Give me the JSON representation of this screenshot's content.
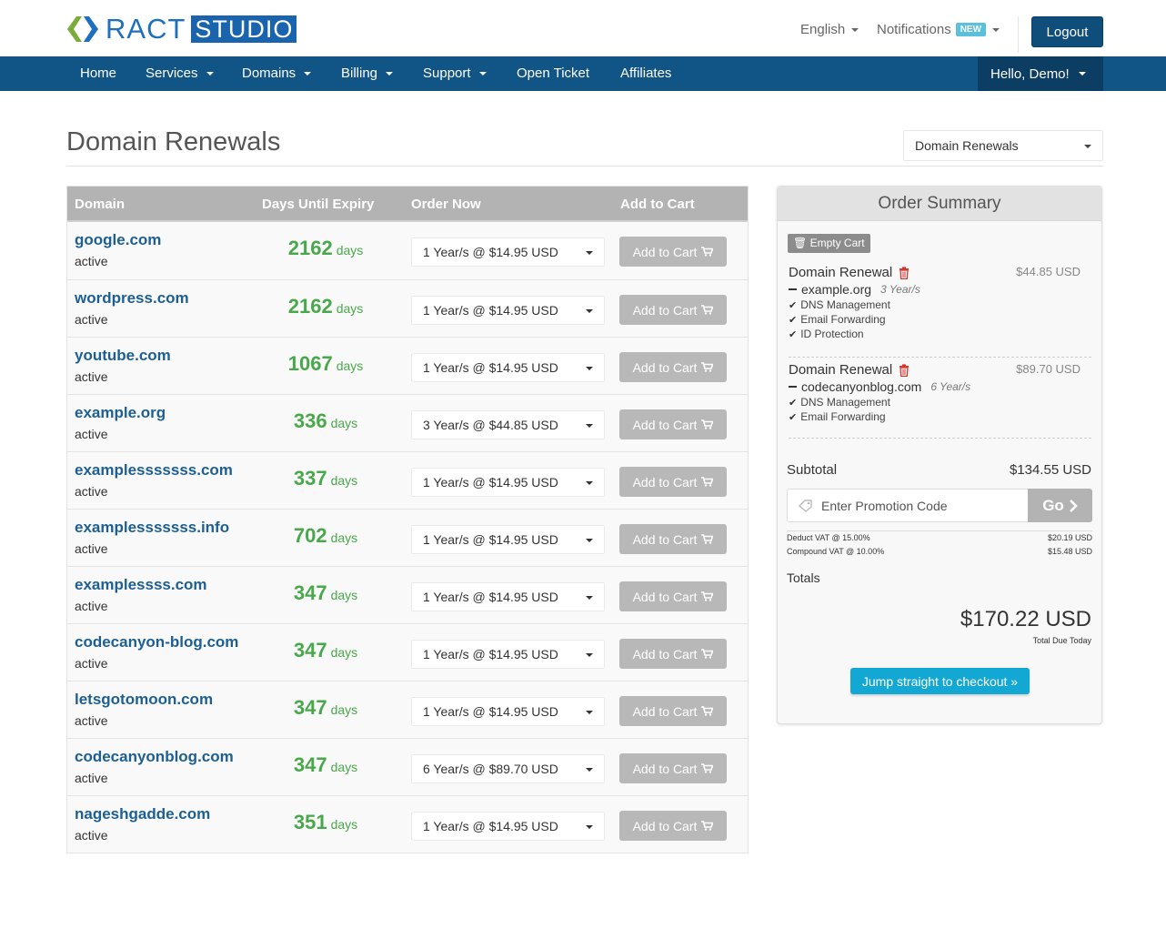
{
  "brand": {
    "ract": "RACT",
    "studio": "STUDIO"
  },
  "topbar": {
    "language": "English",
    "notifications": "Notifications",
    "notifications_badge": "NEW",
    "logout": "Logout"
  },
  "nav": {
    "items": [
      "Home",
      "Services",
      "Domains",
      "Billing",
      "Support",
      "Open Ticket",
      "Affiliates"
    ],
    "greeting": "Hello, Demo!"
  },
  "page": {
    "title": "Domain Renewals",
    "select_value": "Domain Renewals"
  },
  "table": {
    "headers": {
      "domain": "Domain",
      "days": "Days Until Expiry",
      "order": "Order Now",
      "cart": "Add to Cart"
    },
    "days_label": "days",
    "button_label": "Add to Cart",
    "rows": [
      {
        "domain": "google.com",
        "status": "active",
        "days": "2162",
        "option": "1 Year/s @ $14.95 USD"
      },
      {
        "domain": "wordpress.com",
        "status": "active",
        "days": "2162",
        "option": "1 Year/s @ $14.95 USD"
      },
      {
        "domain": "youtube.com",
        "status": "active",
        "days": "1067",
        "option": "1 Year/s @ $14.95 USD"
      },
      {
        "domain": "example.org",
        "status": "active",
        "days": "336",
        "option": "3 Year/s @ $44.85 USD"
      },
      {
        "domain": "examplesssssss.com",
        "status": "active",
        "days": "337",
        "option": "1 Year/s @ $14.95 USD"
      },
      {
        "domain": "examplesssssss.info",
        "status": "active",
        "days": "702",
        "option": "1 Year/s @ $14.95 USD"
      },
      {
        "domain": "examplessss.com",
        "status": "active",
        "days": "347",
        "option": "1 Year/s @ $14.95 USD"
      },
      {
        "domain": "codecanyon-blog.com",
        "status": "active",
        "days": "347",
        "option": "1 Year/s @ $14.95 USD"
      },
      {
        "domain": "letsgotomoon.com",
        "status": "active",
        "days": "347",
        "option": "1 Year/s @ $14.95 USD"
      },
      {
        "domain": "codecanyonblog.com",
        "status": "active",
        "days": "347",
        "option": "6 Year/s @ $89.70 USD"
      },
      {
        "domain": "nageshgadde.com",
        "status": "active",
        "days": "351",
        "option": "1 Year/s @ $14.95 USD"
      }
    ]
  },
  "summary": {
    "title": "Order Summary",
    "empty_cart": "Empty Cart",
    "items": [
      {
        "title": "Domain Renewal",
        "price": "$44.85 USD",
        "domain": "example.org",
        "years": "3 Year/s",
        "addons": [
          "DNS Management",
          "Email Forwarding",
          "ID Protection"
        ]
      },
      {
        "title": "Domain Renewal",
        "price": "$89.70 USD",
        "domain": "codecanyonblog.com",
        "years": "6 Year/s",
        "addons": [
          "DNS Management",
          "Email Forwarding"
        ]
      }
    ],
    "subtotal_label": "Subtotal",
    "subtotal_value": "$134.55 USD",
    "promo_placeholder": "Enter Promotion Code",
    "promo_button": "Go",
    "taxes": [
      {
        "label": "Deduct VAT @ 15.00%",
        "value": "$20.19 USD"
      },
      {
        "label": "Compound VAT @ 10.00%",
        "value": "$15.48 USD"
      }
    ],
    "totals_label": "Totals",
    "total_value": "$170.22 USD",
    "total_due_label": "Total Due Today",
    "checkout_button": "Jump straight to checkout »"
  },
  "colors": {
    "nav_bg": "#115486",
    "link": "#1d5f94",
    "days_green": "#49a84b",
    "checkout": "#13a7d4"
  }
}
